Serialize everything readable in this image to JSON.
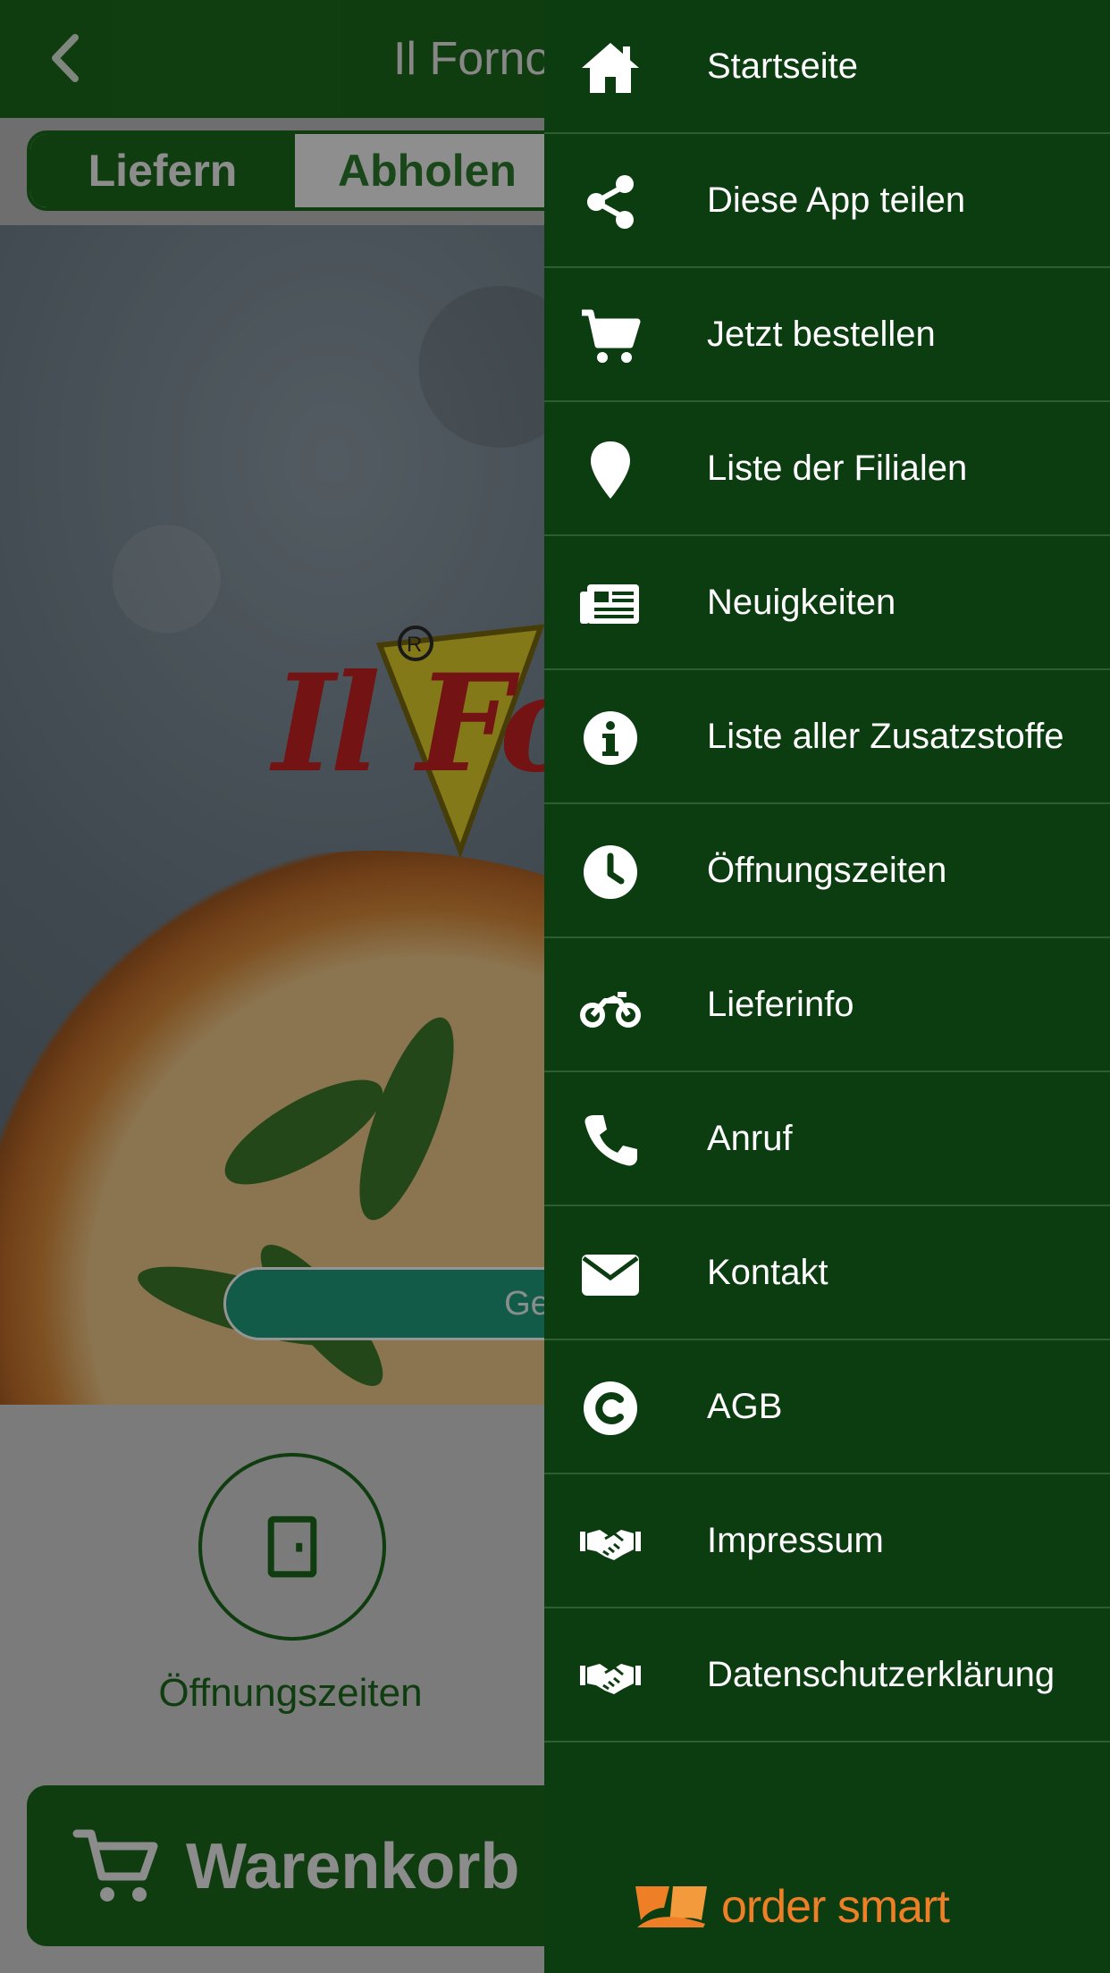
{
  "header": {
    "title": "Il Forno"
  },
  "order_mode": {
    "active": "Liefern",
    "inactive": "Abholen"
  },
  "hero": {
    "logo_text": "Il Fo",
    "status_pill": "Geö"
  },
  "quick_action": {
    "label": "Öffnungszeiten"
  },
  "cart": {
    "label": "Warenkorb"
  },
  "drawer": {
    "items": [
      {
        "label": "Startseite",
        "icon": "home-icon"
      },
      {
        "label": "Diese App teilen",
        "icon": "share-icon"
      },
      {
        "label": "Jetzt bestellen",
        "icon": "cart-icon"
      },
      {
        "label": "Liste der Filialen",
        "icon": "location-pin-icon"
      },
      {
        "label": "Neuigkeiten",
        "icon": "newspaper-icon"
      },
      {
        "label": "Liste aller Zusatzstoffe",
        "icon": "info-icon"
      },
      {
        "label": "Öffnungszeiten",
        "icon": "clock-icon"
      },
      {
        "label": "Lieferinfo",
        "icon": "motorcycle-icon"
      },
      {
        "label": "Anruf",
        "icon": "phone-icon"
      },
      {
        "label": "Kontakt",
        "icon": "envelope-icon"
      },
      {
        "label": "AGB",
        "icon": "copyright-icon"
      },
      {
        "label": "Impressum",
        "icon": "handshake-icon"
      },
      {
        "label": "Datenschutzerklärung",
        "icon": "handshake-icon"
      }
    ],
    "brand": "order smart"
  },
  "colors": {
    "primary_green": "#1c6a1c",
    "drawer_bg": "#0b3d10",
    "brand_orange": "#ef7f26",
    "status_teal": "#1f9d7c"
  }
}
